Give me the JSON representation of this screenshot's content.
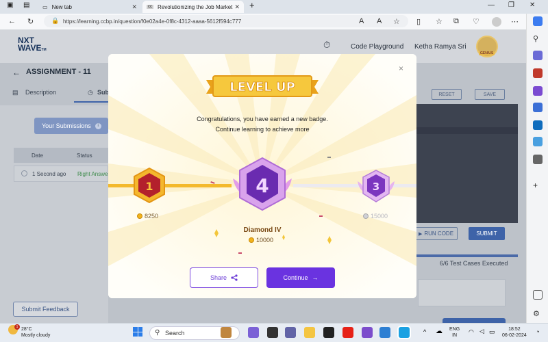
{
  "browser": {
    "tabs": [
      {
        "label": "New tab"
      },
      {
        "label": "Revolutionizing the Job Market |"
      }
    ],
    "url": "https://learning.ccbp.in/question/f0e02a4e-0f8c-4312-aaaa-5612f594c777"
  },
  "header": {
    "logo_line1": "NXT",
    "logo_line2": "WAVE",
    "logo_tm": "TM",
    "playground": "Code Playground",
    "user_name": "Ketha Ramya Sri",
    "avatar_badge": "GENIUS"
  },
  "assignment": {
    "title": "ASSIGNMENT - 11",
    "tabs": [
      "Description",
      "Sub"
    ]
  },
  "submissions": {
    "button": "Your Submissions",
    "columns": [
      "Date",
      "Status"
    ],
    "rows": [
      {
        "date": "1 Second ago",
        "status": "Right Answe"
      }
    ]
  },
  "editor": {
    "reset": "RESET",
    "save": "SAVE",
    "run_code": "RUN CODE",
    "submit": "SUBMIT",
    "tests": "6/6 Test Cases Executed",
    "progress": 1.0
  },
  "feedback_button": "Submit Feedback",
  "modal": {
    "banner": "LEVEL UP",
    "message_line1": "Congratulations, you have earned a new badge.",
    "message_line2": "Continue learning to achieve more",
    "badges": [
      {
        "level": "1",
        "coins": "8250"
      },
      {
        "level": "4",
        "name": "Diamond IV",
        "coins": "10000"
      },
      {
        "level": "3",
        "coins": "15000"
      }
    ],
    "share": "Share",
    "continue": "Continue",
    "close_icon": "×"
  },
  "taskbar": {
    "weather_temp": "28°C",
    "weather_desc": "Mostly cloudy",
    "weather_badge": "1",
    "search": "Search",
    "lang1": "ENG",
    "lang2": "IN",
    "time": "18:52",
    "date": "06-02-2024"
  },
  "colors": {
    "accent_purple": "#6a33e0",
    "gold": "#f3b92c",
    "nav_blue": "#3e63a8"
  }
}
